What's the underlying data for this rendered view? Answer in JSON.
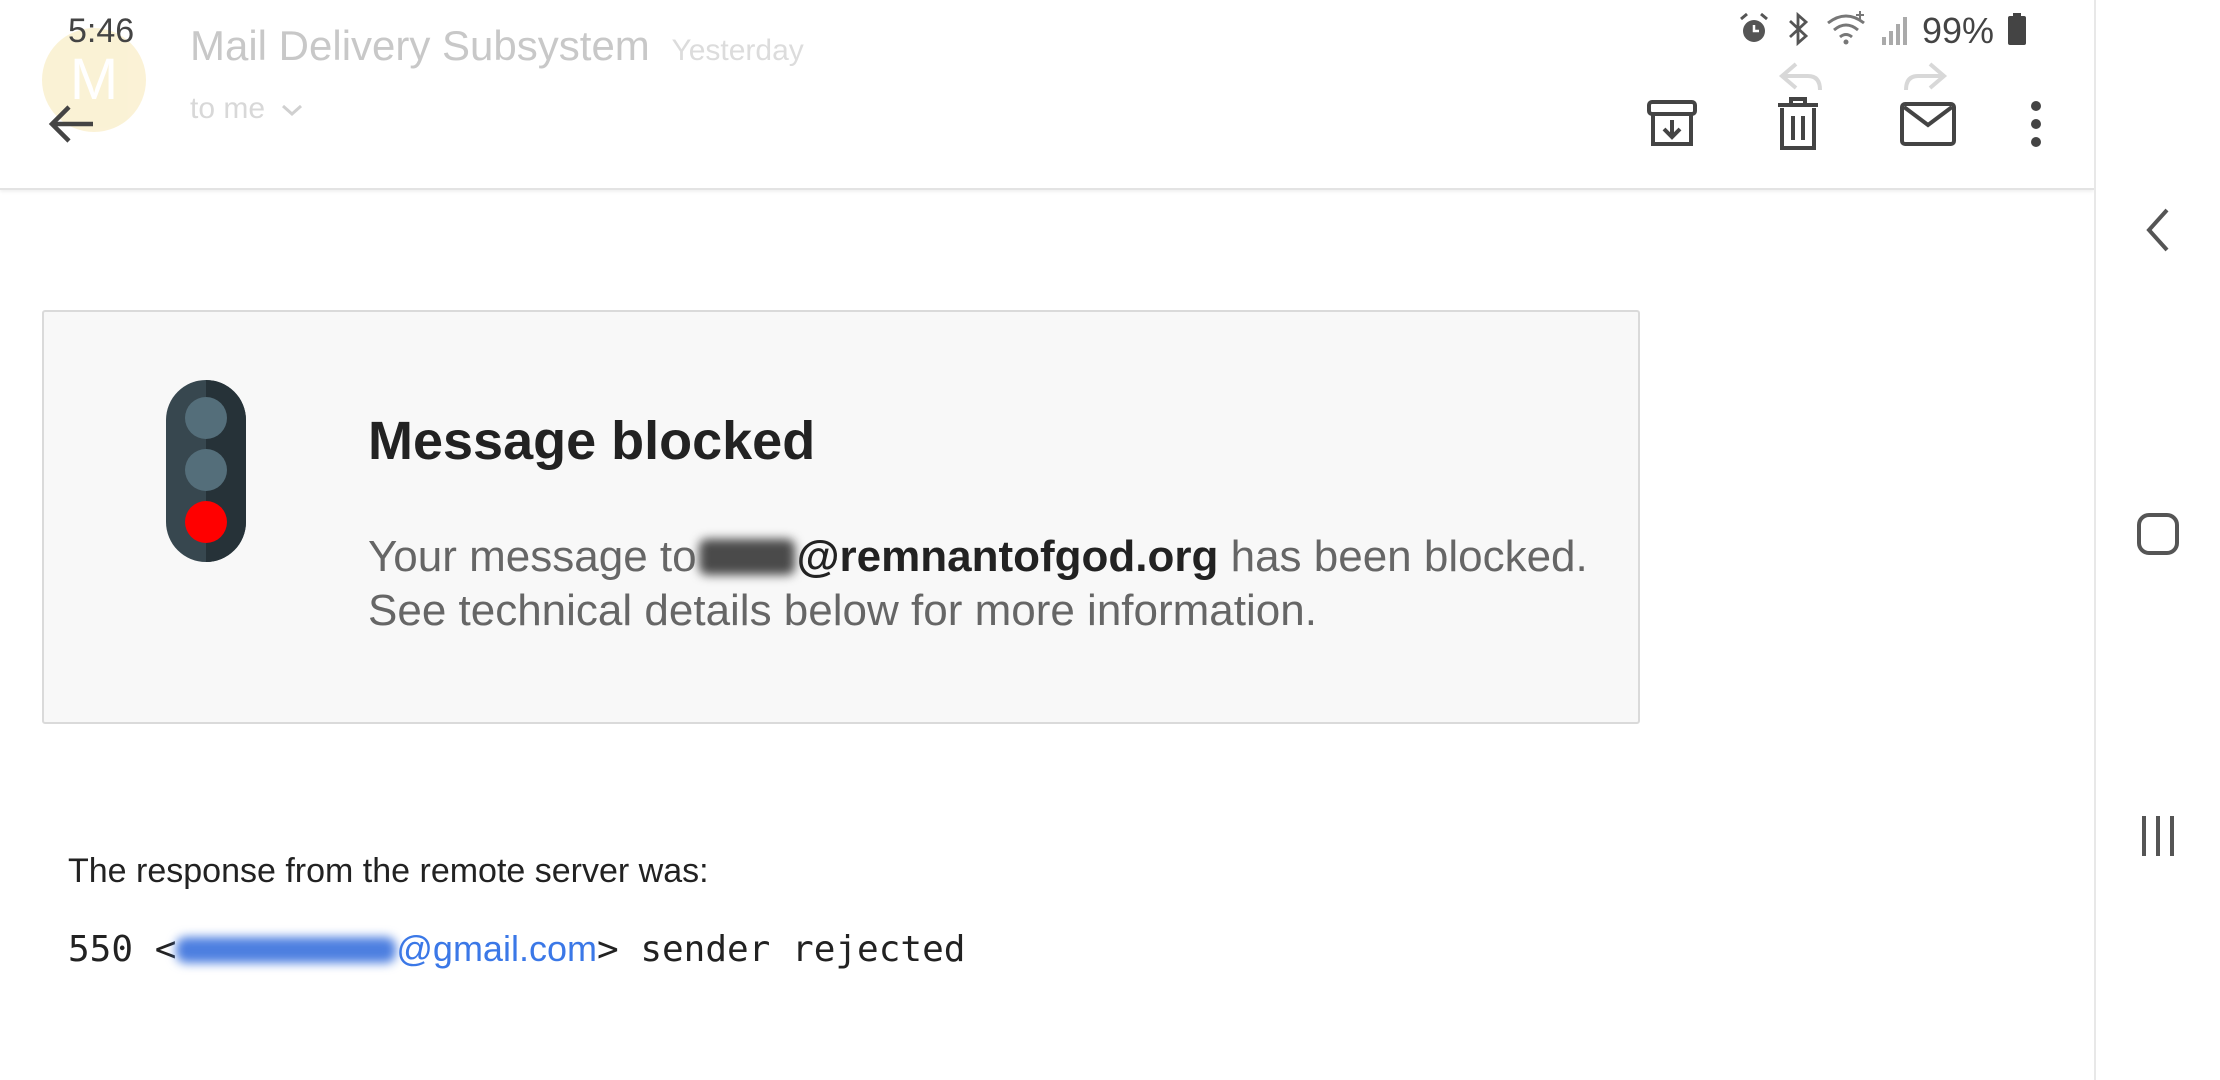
{
  "status_bar": {
    "time": "5:46",
    "battery_percent": "99%",
    "icons": [
      "alarm-icon",
      "bluetooth-icon",
      "wifi-icon",
      "signal-icon",
      "battery-icon"
    ]
  },
  "ghost_header": {
    "avatar_letter": "M",
    "sender": "Mail Delivery Subsystem",
    "date": "Yesterday",
    "recipient": "to me",
    "avatar_color": "#f6e3a4"
  },
  "toolbar": {
    "back_icon": "back-arrow-icon",
    "actions": [
      "archive-icon",
      "delete-icon",
      "mark-unread-icon",
      "more-options-icon"
    ]
  },
  "card": {
    "title": "Message blocked",
    "body_prefix": "Your message to",
    "recipient_domain": "@remnantofgod.org",
    "body_suffix": "has been blocked. See technical details below for more information.",
    "traffic_light_active_color": "#ff0000"
  },
  "response": {
    "label": "The response from the remote server was:",
    "code": "550 <",
    "sender_domain": "@gmail.com",
    "suffix": "> sender rejected",
    "link_color": "#3b78e7"
  },
  "nav": {
    "items": [
      "back-chevron-icon",
      "home-square-icon",
      "recents-icon"
    ]
  }
}
